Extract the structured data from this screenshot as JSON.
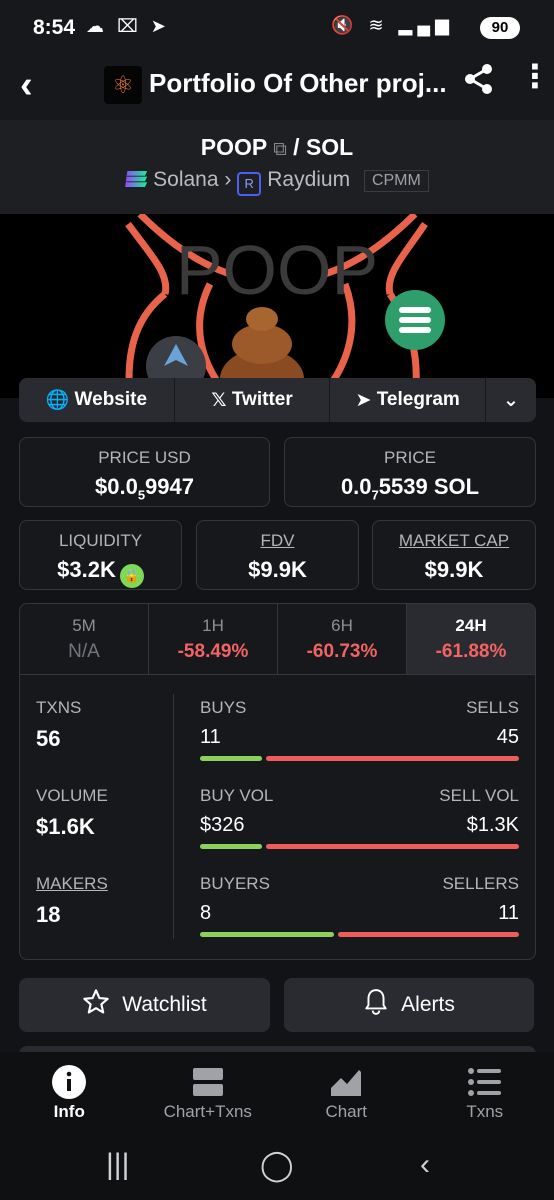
{
  "status": {
    "time": "8:54",
    "battery": "90"
  },
  "appbar": {
    "title": "Portfolio Of Other proj..."
  },
  "pair": {
    "base": "POOP",
    "sep": "/",
    "quote": "SOL",
    "chain": "Solana",
    "dex": "Raydium",
    "tag": "CPMM"
  },
  "banner": {
    "text": "POOP"
  },
  "links": [
    {
      "label": "Website"
    },
    {
      "label": "Twitter"
    },
    {
      "label": "Telegram"
    }
  ],
  "price": {
    "usd_label": "PRICE USD",
    "usd_prefix": "$0.0",
    "usd_zeros": "5",
    "usd_digits": "9947",
    "native_label": "PRICE",
    "native_prefix": "0.0",
    "native_zeros": "7",
    "native_digits": "5539 SOL"
  },
  "stats": {
    "liquidity_label": "LIQUIDITY",
    "liquidity_value": "$3.2K",
    "fdv_label": "FDV",
    "fdv_value": "$9.9K",
    "mcap_label": "MARKET CAP",
    "mcap_value": "$9.9K"
  },
  "timeframes": [
    {
      "label": "5M",
      "value": "N/A"
    },
    {
      "label": "1H",
      "value": "-58.49%"
    },
    {
      "label": "6H",
      "value": "-60.73%"
    },
    {
      "label": "24H",
      "value": "-61.88%"
    }
  ],
  "metrics": {
    "txns_label": "TXNS",
    "txns_value": "56",
    "buys_label": "BUYS",
    "buys_value": "11",
    "sells_label": "SELLS",
    "sells_value": "45",
    "volume_label": "VOLUME",
    "volume_value": "$1.6K",
    "buyvol_label": "BUY VOL",
    "buyvol_value": "$326",
    "sellvol_label": "SELL VOL",
    "sellvol_value": "$1.3K",
    "makers_label": "MAKERS",
    "makers_value": "18",
    "buyers_label": "BUYERS",
    "buyers_value": "8",
    "sellers_label": "SELLERS",
    "sellers_value": "11"
  },
  "actions": {
    "watchlist": "Watchlist",
    "alerts": "Alerts"
  },
  "nav": [
    {
      "label": "Info"
    },
    {
      "label": "Chart+Txns"
    },
    {
      "label": "Chart"
    },
    {
      "label": "Txns"
    }
  ],
  "colors": {
    "positive": "#8bd15b",
    "negative": "#ee5c5c",
    "accent": "#3fa877"
  }
}
